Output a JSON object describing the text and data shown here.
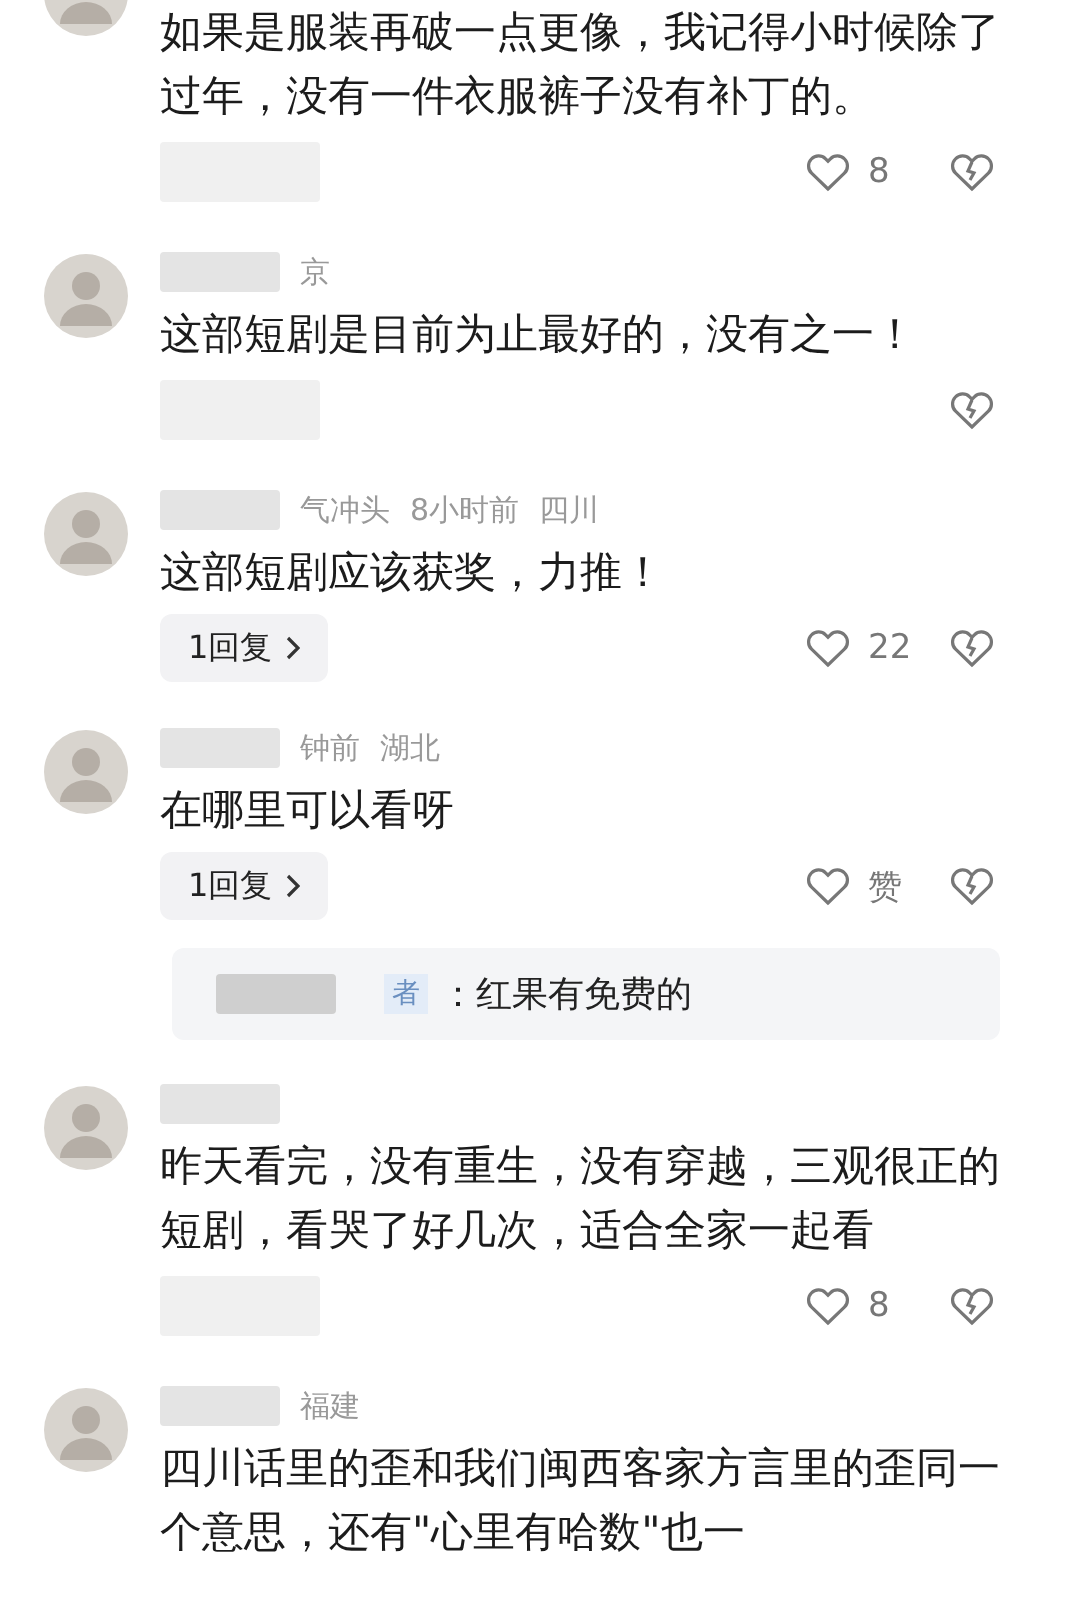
{
  "comments": [
    {
      "body": "如果是服装再破一点更像，我记得小时候除了过年，没有一件衣服裤子没有补丁的。",
      "likes": "8"
    },
    {
      "meta": [
        "京"
      ],
      "body": "这部短剧是目前为止最好的，没有之一！"
    },
    {
      "meta": [
        "气冲头",
        "8小时前",
        "四川"
      ],
      "body": "这部短剧应该获奖，力推！",
      "replies": "1回复",
      "likes": "22"
    },
    {
      "meta": [
        "钟前",
        "湖北"
      ],
      "body": "在哪里可以看呀",
      "replies": "1回复",
      "likes": "赞",
      "reply_preview": {
        "tag": "者",
        "text": "：红果有免费的"
      }
    },
    {
      "body": "昨天看完，没有重生，没有穿越，三观很正的短剧，看哭了好几次，适合全家一起看",
      "likes": "8"
    },
    {
      "meta": [
        "福建"
      ],
      "body": "四川话里的歪和我们闽西客家方言里的歪同一个意思，还有\"心里有哈数\"也一"
    }
  ]
}
